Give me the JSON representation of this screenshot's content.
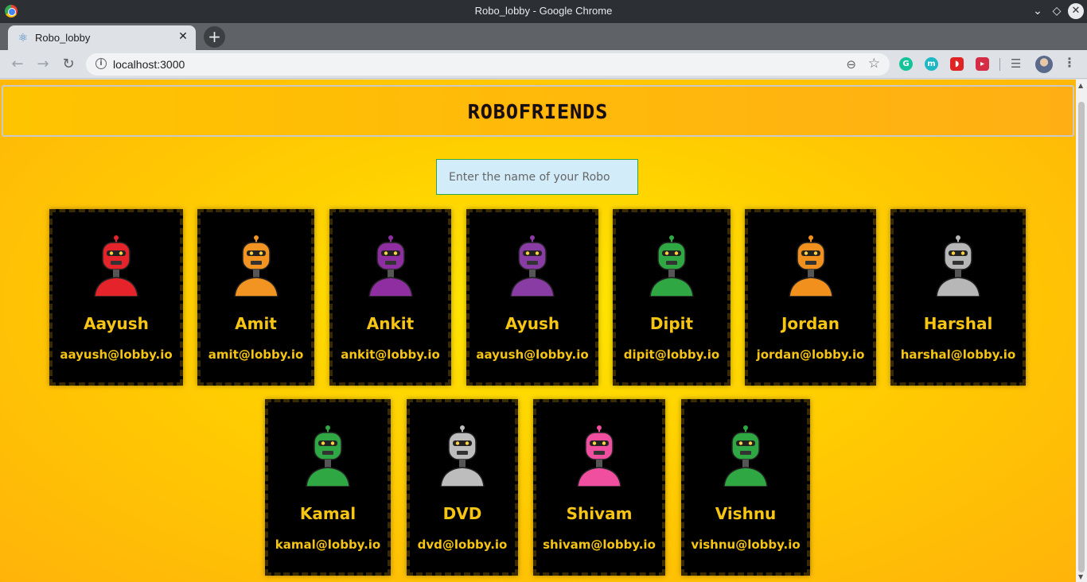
{
  "window": {
    "title": "Robo_lobby - Google Chrome"
  },
  "tab": {
    "title": "Robo_lobby",
    "close": "✕",
    "new_tab": "+"
  },
  "toolbar": {
    "url": "localhost:3000"
  },
  "page": {
    "logo": "ROBOFRIENDS",
    "search_placeholder": "Enter the name of your Robo"
  },
  "robots": [
    {
      "name": "Aayush",
      "email": "aayush@lobby.io",
      "color": "#e5232a"
    },
    {
      "name": "Amit",
      "email": "amit@lobby.io",
      "color": "#f29421"
    },
    {
      "name": "Ankit",
      "email": "ankit@lobby.io",
      "color": "#8e2ea0"
    },
    {
      "name": "Ayush",
      "email": "aayush@lobby.io",
      "color": "#8a3ca5"
    },
    {
      "name": "Dipit",
      "email": "dipit@lobby.io",
      "color": "#2fa843"
    },
    {
      "name": "Jordan",
      "email": "jordan@lobby.io",
      "color": "#f2901e"
    },
    {
      "name": "Harshal",
      "email": "harshal@lobby.io",
      "color": "#b7b7b7"
    },
    {
      "name": "Kamal",
      "email": "kamal@lobby.io",
      "color": "#2fa843"
    },
    {
      "name": "DVD",
      "email": "dvd@lobby.io",
      "color": "#bdbdbd"
    },
    {
      "name": "Shivam",
      "email": "shivam@lobby.io",
      "color": "#f04fa0"
    },
    {
      "name": "Vishnu",
      "email": "vishnu@lobby.io",
      "color": "#2fa843"
    }
  ]
}
